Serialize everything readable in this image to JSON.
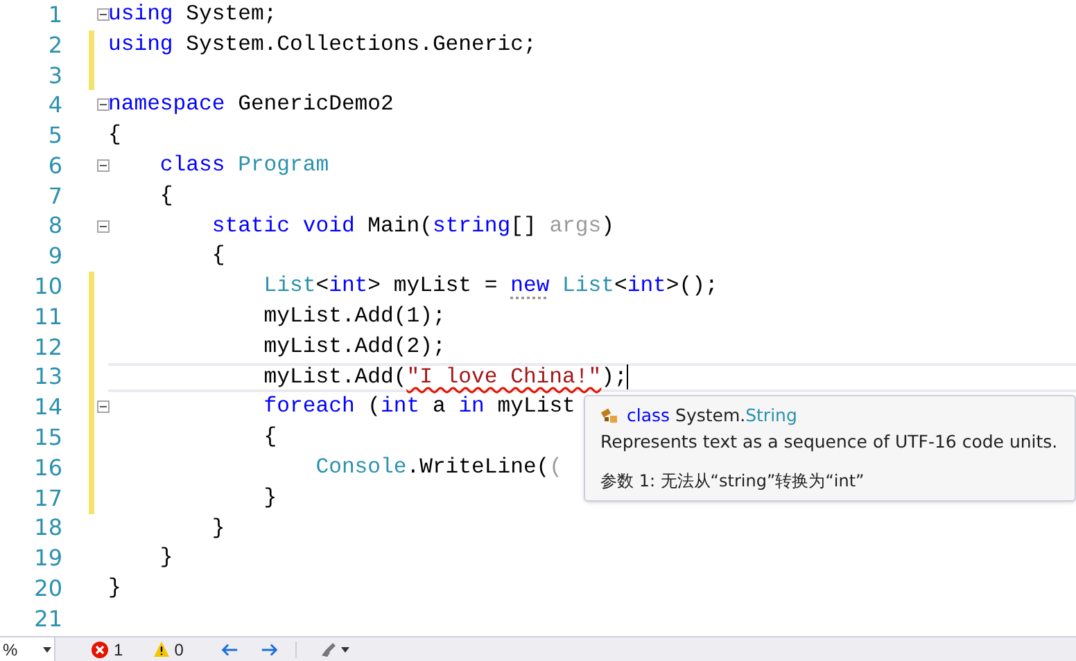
{
  "editor": {
    "lines": [
      {
        "number": "1",
        "changed": false,
        "fold": true,
        "current": false,
        "tokens": [
          {
            "kind": "keyword",
            "text": "using"
          },
          {
            "kind": "plain",
            "text": " System;"
          }
        ]
      },
      {
        "number": "2",
        "changed": true,
        "fold": false,
        "current": false,
        "tokens": [
          {
            "kind": "keyword",
            "text": "using"
          },
          {
            "kind": "plain",
            "text": " System.Collections.Generic;"
          }
        ]
      },
      {
        "number": "3",
        "changed": true,
        "fold": false,
        "current": false
      },
      {
        "number": "4",
        "changed": false,
        "fold": true,
        "current": false,
        "tokens": [
          {
            "kind": "keyword",
            "text": "namespace"
          },
          {
            "kind": "plain",
            "text": " GenericDemo2"
          }
        ]
      },
      {
        "number": "5",
        "changed": false,
        "fold": false,
        "current": false,
        "tokens": [
          {
            "kind": "plain",
            "text": "{"
          }
        ]
      },
      {
        "number": "6",
        "changed": false,
        "fold": true,
        "current": false,
        "tokens": [
          {
            "kind": "keyword",
            "text": "    class"
          },
          {
            "kind": "type",
            "text": " Program"
          }
        ]
      },
      {
        "number": "7",
        "changed": false,
        "fold": false,
        "current": false,
        "tokens": [
          {
            "kind": "plain",
            "text": "    {"
          }
        ]
      },
      {
        "number": "8",
        "changed": false,
        "fold": true,
        "current": false,
        "tokens": [
          {
            "kind": "keyword",
            "text": "        static void"
          },
          {
            "kind": "plain",
            "text": " Main("
          },
          {
            "kind": "keyword",
            "text": "string"
          },
          {
            "kind": "plain",
            "text": "[]"
          },
          {
            "kind": "unused",
            "text": " args"
          },
          {
            "kind": "plain",
            "text": ")"
          }
        ]
      },
      {
        "number": "9",
        "changed": false,
        "fold": false,
        "current": false,
        "tokens": [
          {
            "kind": "plain",
            "text": "        {"
          }
        ]
      },
      {
        "number": "10",
        "changed": true,
        "fold": false,
        "current": false,
        "tokens": [
          {
            "kind": "type",
            "text": "            List"
          },
          {
            "kind": "plain",
            "text": "<"
          },
          {
            "kind": "keyword",
            "text": "int"
          },
          {
            "kind": "plain",
            "text": "> myList = "
          },
          {
            "kind": "hinted_keyword",
            "text": "new"
          },
          {
            "kind": "type",
            "text": " List"
          },
          {
            "kind": "plain",
            "text": "<"
          },
          {
            "kind": "keyword",
            "text": "int"
          },
          {
            "kind": "plain",
            "text": ">();"
          }
        ]
      },
      {
        "number": "11",
        "changed": true,
        "fold": false,
        "current": false,
        "tokens": [
          {
            "kind": "plain",
            "text": "            myList.Add(1);"
          }
        ]
      },
      {
        "number": "12",
        "changed": true,
        "fold": false,
        "current": false,
        "tokens": [
          {
            "kind": "plain",
            "text": "            myList.Add(2);"
          }
        ]
      },
      {
        "number": "13",
        "changed": true,
        "fold": false,
        "current": true,
        "tokens": [
          {
            "kind": "plain",
            "text": "            myList.Add("
          },
          {
            "kind": "error_string",
            "text": "\"I love China!\""
          },
          {
            "kind": "plain",
            "text": ");"
          }
        ]
      },
      {
        "number": "14",
        "changed": true,
        "fold": true,
        "current": false,
        "tokens": [
          {
            "kind": "keyword",
            "text": "            foreach"
          },
          {
            "kind": "plain",
            "text": " ("
          },
          {
            "kind": "keyword",
            "text": "int"
          },
          {
            "kind": "plain",
            "text": " a "
          },
          {
            "kind": "keyword",
            "text": "in"
          },
          {
            "kind": "plain",
            "text": " myList"
          }
        ]
      },
      {
        "number": "15",
        "changed": true,
        "fold": false,
        "current": false,
        "tokens": [
          {
            "kind": "plain",
            "text": "            {"
          }
        ]
      },
      {
        "number": "16",
        "changed": true,
        "fold": false,
        "current": false,
        "tokens": [
          {
            "kind": "type",
            "text": "                Console"
          },
          {
            "kind": "plain",
            "text": ".WriteLine("
          },
          {
            "kind": "unused",
            "text": "("
          }
        ]
      },
      {
        "number": "17",
        "changed": true,
        "fold": false,
        "current": false,
        "tokens": [
          {
            "kind": "plain",
            "text": "            }"
          }
        ]
      },
      {
        "number": "18",
        "changed": false,
        "fold": false,
        "current": false,
        "tokens": [
          {
            "kind": "plain",
            "text": "        }"
          }
        ]
      },
      {
        "number": "19",
        "changed": false,
        "fold": false,
        "current": false,
        "tokens": [
          {
            "kind": "plain",
            "text": "    }"
          }
        ]
      },
      {
        "number": "20",
        "changed": false,
        "fold": false,
        "current": false,
        "tokens": [
          {
            "kind": "plain",
            "text": "}"
          }
        ]
      },
      {
        "number": "21",
        "changed": false,
        "fold": false,
        "current": false
      }
    ]
  },
  "tooltip": {
    "signature": [
      {
        "kind": "keyword",
        "text": "class"
      },
      {
        "kind": "plain",
        "text": " System."
      },
      {
        "kind": "type",
        "text": "String"
      }
    ],
    "description": "Represents text as a sequence of UTF-16 code units.",
    "error": "参数 1: 无法从“string”转换为“int”"
  },
  "status_bar": {
    "zoom": "%",
    "errors": "1",
    "warnings": "0"
  }
}
